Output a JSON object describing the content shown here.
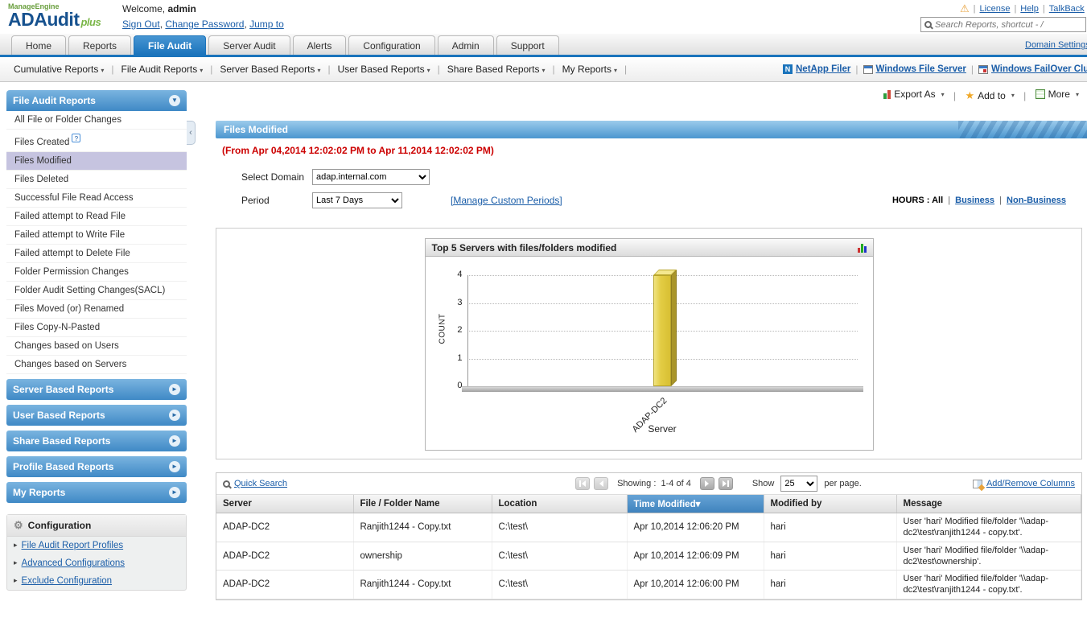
{
  "colors": {
    "accent_blue": "#1b74bc",
    "link_blue": "#1a5da8",
    "selected_item_bg": "#c6c4e0",
    "alert_red": "#cc0000",
    "bar_yellow": "#e3cd44",
    "sorted_header_blue": "#4f92c9"
  },
  "header": {
    "logo": {
      "manageengine": "ManageEngine",
      "product": "ADAudit",
      "plus": "plus"
    },
    "welcome": "Welcome,",
    "username": "admin",
    "account_links": [
      "Sign Out",
      "Change Password",
      "Jump to"
    ],
    "warning_icon": "warning-icon",
    "top_links": [
      "License",
      "Help",
      "TalkBack"
    ],
    "search": {
      "placeholder": "Search Reports, shortcut - /"
    }
  },
  "nav": {
    "tabs": [
      {
        "label": "Home",
        "active": false
      },
      {
        "label": "Reports",
        "active": false
      },
      {
        "label": "File Audit",
        "active": true
      },
      {
        "label": "Server Audit",
        "active": false
      },
      {
        "label": "Alerts",
        "active": false
      },
      {
        "label": "Configuration",
        "active": false
      },
      {
        "label": "Admin",
        "active": false
      },
      {
        "label": "Support",
        "active": false
      }
    ],
    "domain_settings": "Domain Settings"
  },
  "toolbar": {
    "menus": [
      "Cumulative Reports",
      "File Audit Reports",
      "Server Based Reports",
      "User Based Reports",
      "Share Based Reports",
      "My Reports"
    ],
    "links": [
      {
        "label": "NetApp Filer",
        "icon": "netapp-icon"
      },
      {
        "label": "Windows File Server",
        "icon": "windows-file-server-icon"
      },
      {
        "label": "Windows FailOver Cluster",
        "icon": "windows-failover-cluster-icon"
      }
    ]
  },
  "sidebar": {
    "main_section": {
      "title": "File Audit Reports"
    },
    "items": [
      {
        "label": "All File or Folder Changes"
      },
      {
        "label": "Files Created",
        "badge": "?"
      },
      {
        "label": "Files Modified",
        "selected": true
      },
      {
        "label": "Files Deleted"
      },
      {
        "label": "Successful File Read Access"
      },
      {
        "label": "Failed attempt to Read File"
      },
      {
        "label": "Failed attempt to Write File"
      },
      {
        "label": "Failed attempt to Delete File"
      },
      {
        "label": "Folder Permission Changes"
      },
      {
        "label": "Folder Audit Setting Changes(SACL)"
      },
      {
        "label": "Files Moved (or) Renamed"
      },
      {
        "label": "Files Copy-N-Pasted"
      },
      {
        "label": "Changes based on Users"
      },
      {
        "label": "Changes based on Servers"
      }
    ],
    "collapsed_sections": [
      "Server Based Reports",
      "User Based Reports",
      "Share Based Reports",
      "Profile Based Reports",
      "My Reports"
    ],
    "configuration": {
      "title": "Configuration",
      "links": [
        "File Audit Report Profiles",
        "Advanced Configurations",
        "Exclude Configuration"
      ]
    }
  },
  "main": {
    "actions": {
      "export_as": "Export As",
      "add_to": "Add to",
      "more": "More"
    },
    "title": "Files Modified",
    "period_text": "(From Apr 04,2014 12:02:02 PM to Apr 11,2014 12:02:02 PM)",
    "filters": {
      "domain_label": "Select Domain",
      "domain_value": "adap.internal.com",
      "period_label": "Period",
      "period_value": "Last 7 Days",
      "manage_custom_periods": "[Manage Custom Periods]",
      "hours_label": "HOURS : ",
      "hours_all": "All",
      "hours_business": "Business",
      "hours_non_business": "Non-Business"
    },
    "table": {
      "quick_search": "Quick Search",
      "showing_label": "Showing :",
      "showing_range": "1-4 of 4",
      "show_label": "Show",
      "page_size": "25",
      "per_page": "per page.",
      "add_remove_columns": "Add/Remove Columns",
      "columns": [
        "Server",
        "File / Folder Name",
        "Location",
        "Time Modified",
        "Modified by",
        "Message"
      ],
      "sorted_column": "Time Modified",
      "rows": [
        {
          "server": "ADAP-DC2",
          "file": "Ranjith1244 - Copy.txt",
          "location": "C:\\test\\",
          "time": "Apr 10,2014 12:06:20 PM",
          "modified_by": "hari",
          "message": "User 'hari' Modified file/folder '\\\\adap-dc2\\test\\ranjith1244 - copy.txt'."
        },
        {
          "server": "ADAP-DC2",
          "file": "ownership",
          "location": "C:\\test\\",
          "time": "Apr 10,2014 12:06:09 PM",
          "modified_by": "hari",
          "message": "User 'hari' Modified file/folder '\\\\adap-dc2\\test\\ownership'."
        },
        {
          "server": "ADAP-DC2",
          "file": "Ranjith1244 - Copy.txt",
          "location": "C:\\test\\",
          "time": "Apr 10,2014 12:06:00 PM",
          "modified_by": "hari",
          "message": "User 'hari' Modified file/folder '\\\\adap-dc2\\test\\ranjith1244 - copy.txt'."
        }
      ]
    }
  },
  "chart_data": {
    "type": "bar",
    "title": "Top 5 Servers with files/folders modified",
    "categories": [
      "ADAP-DC2"
    ],
    "values": [
      4
    ],
    "xlabel": "Server",
    "ylabel": "COUNT",
    "ylim": [
      0,
      4
    ],
    "yticks": [
      0,
      1,
      2,
      3,
      4
    ],
    "grid": "dotted-horizontal",
    "bar_color": "#e3cd44"
  }
}
